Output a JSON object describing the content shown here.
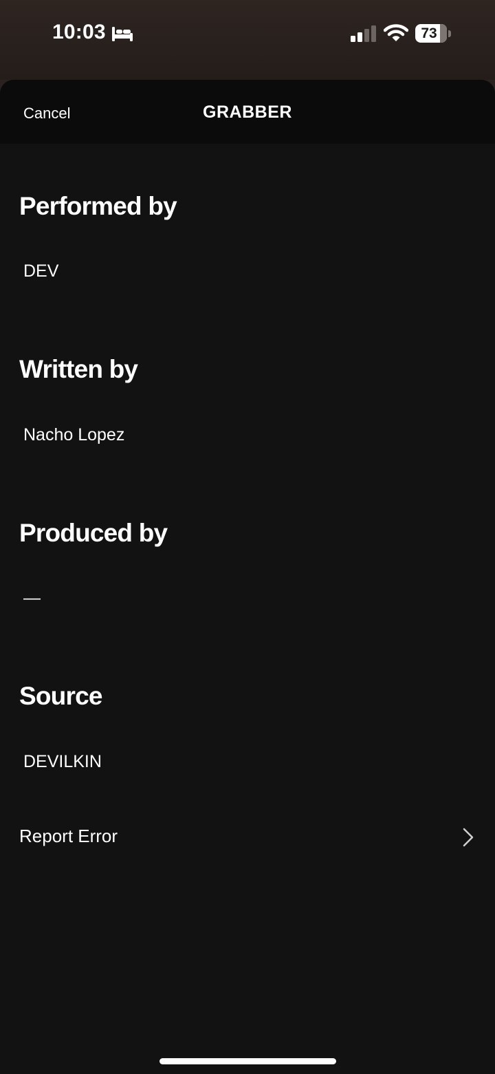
{
  "status_bar": {
    "time": "10:03",
    "focus_icon": "bed-icon",
    "signal_icon": "cellular-signal-icon",
    "wifi_icon": "wifi-icon",
    "battery_percent": "73"
  },
  "header": {
    "cancel_label": "Cancel",
    "title": "GRABBER"
  },
  "credits": {
    "performed_by": {
      "heading": "Performed by",
      "value": "DEV"
    },
    "written_by": {
      "heading": "Written by",
      "value": "Nacho Lopez"
    },
    "produced_by": {
      "heading": "Produced by",
      "value": "—"
    },
    "source": {
      "heading": "Source",
      "value": "DEVILKIN"
    }
  },
  "report": {
    "label": "Report Error",
    "icon": "chevron-right-icon"
  },
  "colors": {
    "sheet_background": "#121212",
    "header_background": "#0b0b0b",
    "status_background": "#2a221f",
    "text": "#ffffff"
  }
}
